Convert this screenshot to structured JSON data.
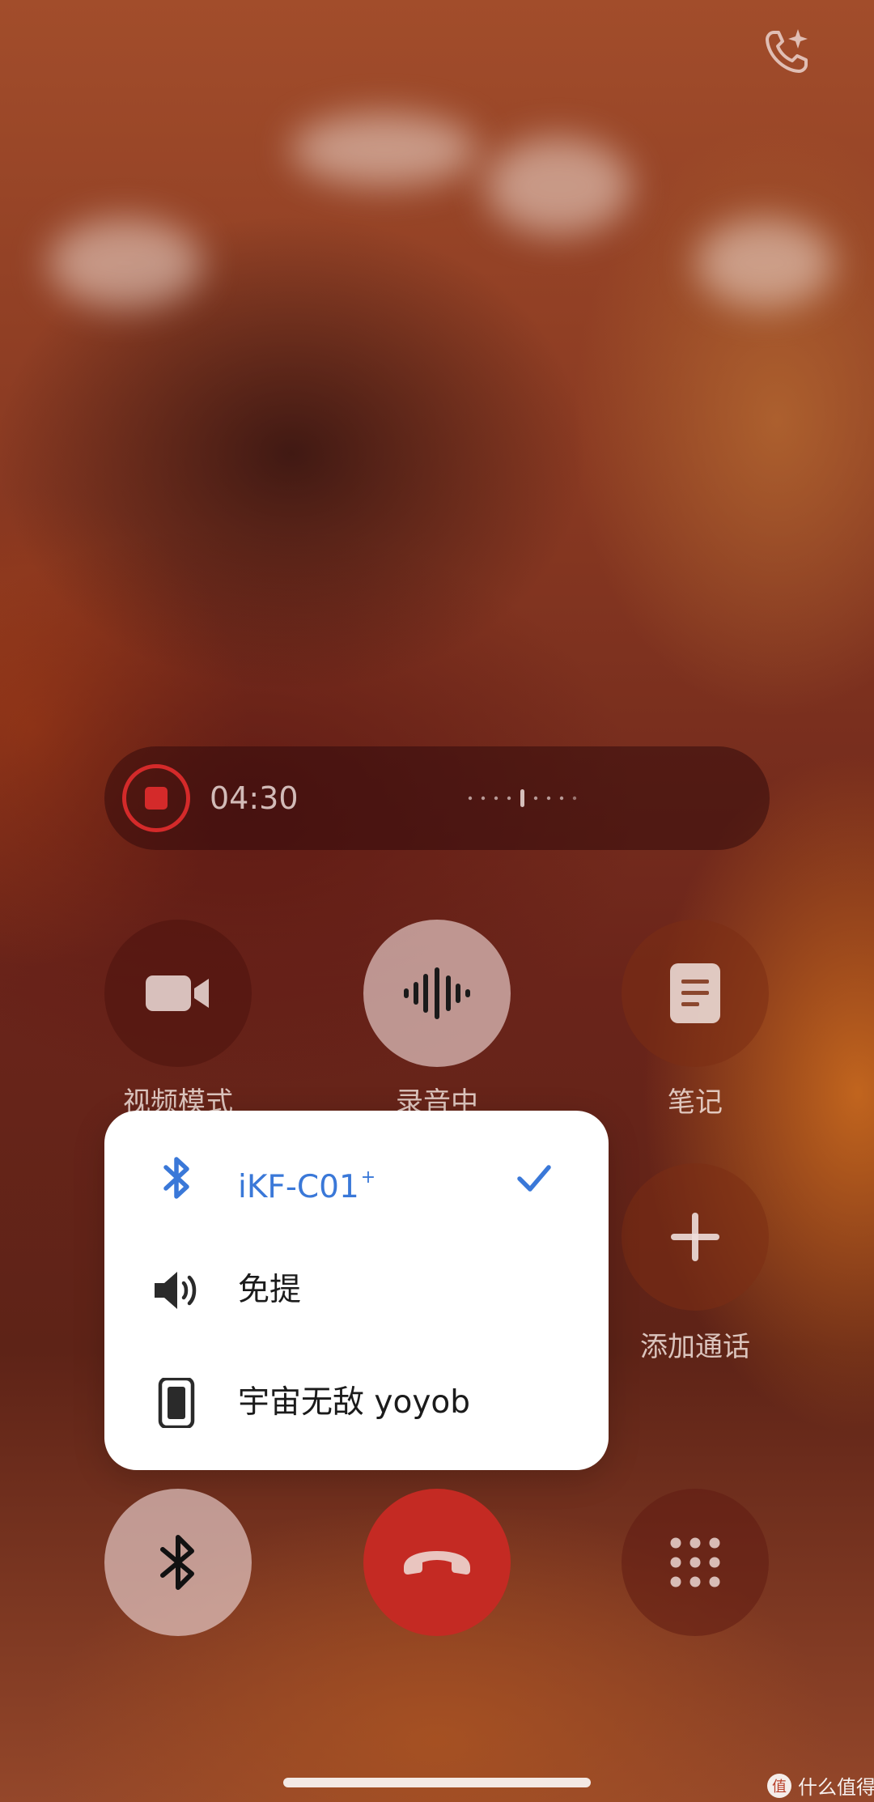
{
  "recording": {
    "timer": "04:30"
  },
  "controls": {
    "video_label": "视频模式",
    "record_label": "录音中",
    "notes_label": "笔记",
    "add_call_label": "添加通话"
  },
  "audio_menu": {
    "items": [
      {
        "label": "iKF-C01",
        "superscript": "+",
        "icon": "bluetooth-icon",
        "selected": true
      },
      {
        "label": "免提",
        "icon": "speaker-icon",
        "selected": false
      },
      {
        "label": "宇宙无敌 yoyob",
        "icon": "phone-device-icon",
        "selected": false
      }
    ]
  },
  "watermark": {
    "badge": "值",
    "text": "什么值得买"
  },
  "colors": {
    "accent_blue": "#3a78d8",
    "record_red": "#d42a2a",
    "hangup_red": "#c42a23"
  }
}
